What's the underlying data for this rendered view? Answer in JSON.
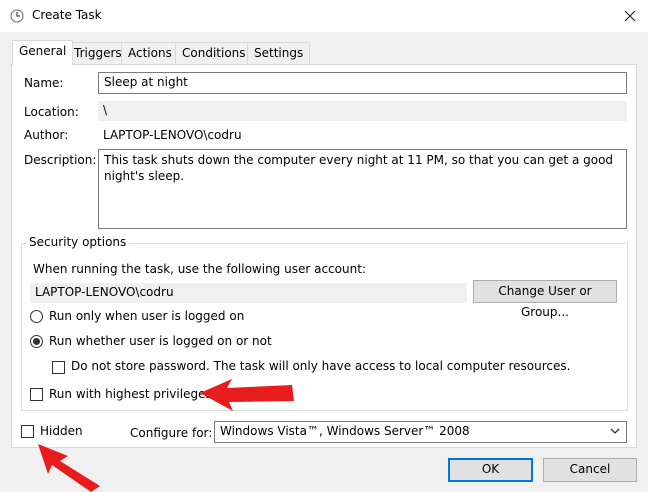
{
  "window": {
    "title": "Create Task",
    "close_icon": "close-icon"
  },
  "tabs": [
    {
      "label": "General",
      "active": true
    },
    {
      "label": "Triggers"
    },
    {
      "label": "Actions"
    },
    {
      "label": "Conditions"
    },
    {
      "label": "Settings"
    }
  ],
  "general": {
    "name_label": "Name:",
    "name_value": "Sleep at night",
    "location_label": "Location:",
    "location_value": "\\",
    "author_label": "Author:",
    "author_value": "LAPTOP-LENOVO\\codru",
    "description_label": "Description:",
    "description_value": "This task shuts down the computer every night at 11 PM, so that you can get a good night's sleep."
  },
  "security": {
    "title": "Security options",
    "account_prompt": "When running the task, use the following user account:",
    "account_value": "LAPTOP-LENOVO\\codru",
    "change_button": "Change User or Group...",
    "radio_logged_on": "Run only when user is logged on",
    "radio_whether": "Run whether user is logged on or not",
    "radio_selected": "whether",
    "no_store_password": "Do not store password.  The task will only have access to local computer resources.",
    "highest_privileges": "Run with highest privileges"
  },
  "bottom": {
    "hidden_label": "Hidden",
    "configure_label": "Configure for:",
    "configure_value": "Windows Vista™, Windows Server™ 2008",
    "ok": "OK",
    "cancel": "Cancel"
  },
  "colors": {
    "accent": "#0078d7",
    "arrow": "#e81c1c"
  }
}
